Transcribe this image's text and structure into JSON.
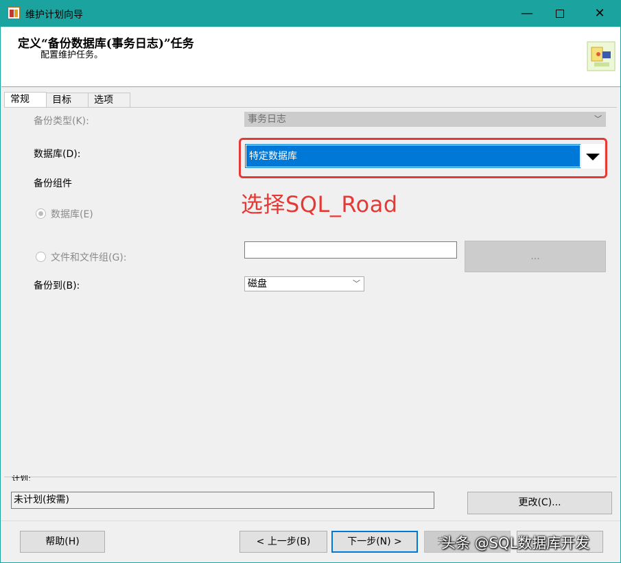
{
  "window": {
    "title": "维护计划向导"
  },
  "header": {
    "title": "定义“备份数据库(事务日志)”任务",
    "subtitle": "配置维护任务。"
  },
  "tabs": [
    {
      "label": "常规"
    },
    {
      "label": "目标"
    },
    {
      "label": "选项"
    }
  ],
  "form": {
    "backup_type_label": "备份类型(K):",
    "backup_type_value": "事务日志",
    "database_label": "数据库(D):",
    "database_value": "特定数据库",
    "backup_component_label": "备份组件",
    "radio_database_label": "数据库(E)",
    "radio_files_label": "文件和文件组(G):",
    "browse_label": "...",
    "backup_to_label": "备份到(B):",
    "backup_to_value": "磁盘"
  },
  "annotation": {
    "text": "选择SQL_Road",
    "color": "#e53935"
  },
  "schedule": {
    "label": "计划:",
    "value": "未计划(按需)",
    "change_button": "更改(C)..."
  },
  "footer": {
    "help": "帮助(H)",
    "back": "< 上一步(B)",
    "next": "下一步(N) >",
    "finish": "完",
    "cancel": "取消"
  },
  "watermark": "头条 @SQL数据库开发",
  "colors": {
    "titlebar": "#1aa39f",
    "selection": "#0078d7",
    "annotation": "#e53935"
  }
}
